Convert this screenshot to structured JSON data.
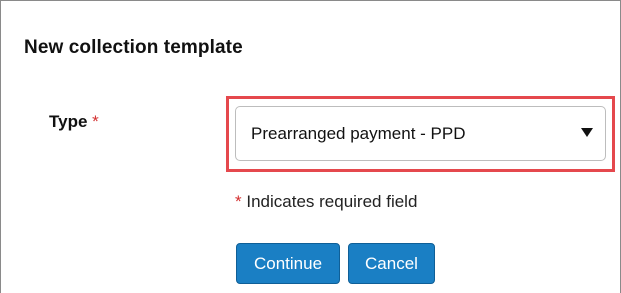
{
  "dialog": {
    "title": "New collection template"
  },
  "form": {
    "type_label": "Type",
    "required_marker": "*",
    "type_value": "Prearranged payment - PPD",
    "required_note_marker": "*",
    "required_note_text": "Indicates required field"
  },
  "buttons": {
    "continue_label": "Continue",
    "cancel_label": "Cancel"
  },
  "colors": {
    "button_bg": "#1a7fc4",
    "highlight_border": "#e5484d",
    "required_star": "#d32f2f"
  },
  "icons": {
    "select_caret": "caret-down-icon"
  }
}
